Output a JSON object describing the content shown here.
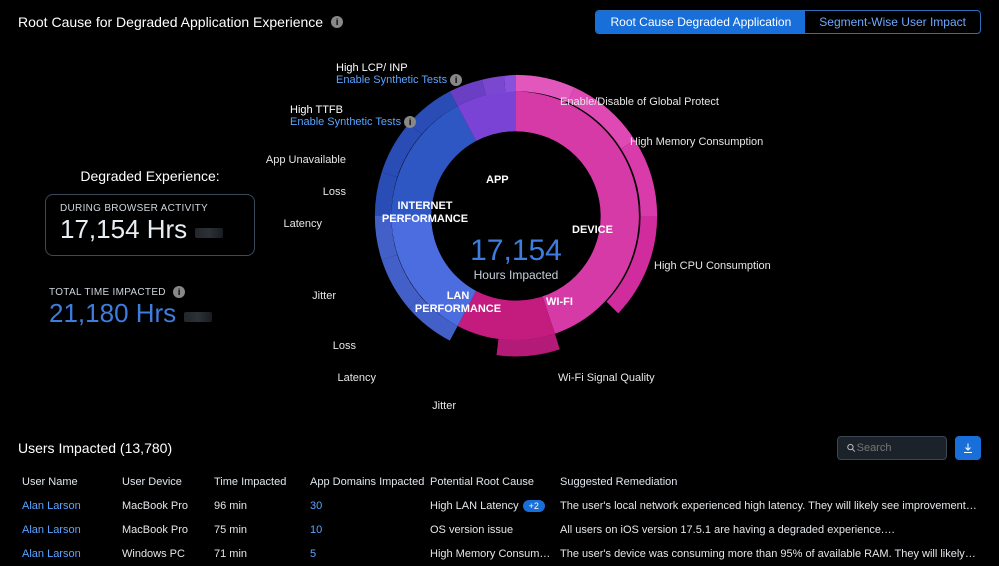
{
  "header": {
    "title": "Root Cause for Degraded Application Experience",
    "tabs": [
      "Root Cause Degraded Application",
      "Segment-Wise User Impact"
    ],
    "active_tab": 0
  },
  "stats": {
    "heading": "Degraded Experience:",
    "browser": {
      "label": "DURING BROWSER ACTIVITY",
      "value": "17,154 Hrs"
    },
    "total": {
      "label": "TOTAL TIME IMPACTED",
      "value": "21,180 Hrs"
    }
  },
  "chart_data": {
    "type": "sunburst",
    "center": {
      "value": "17,154",
      "label": "Hours Impacted"
    },
    "segments": [
      {
        "name": "APP",
        "color": "#6a3fc4",
        "share": 0.14,
        "children": [
          {
            "name": "High LCP/ INP",
            "link": "Enable Synthetic Tests"
          },
          {
            "name": "High TTFB",
            "link": "Enable Synthetic Tests"
          },
          {
            "name": "App Unavailable"
          }
        ]
      },
      {
        "name": "INTERNET PERFORMANCE",
        "color": "#2f57c4",
        "share": 0.14,
        "children": [
          {
            "name": "Loss"
          },
          {
            "name": "Latency"
          },
          {
            "name": "Jitter"
          }
        ]
      },
      {
        "name": "LAN PERFORMANCE",
        "color": "#4b6de0",
        "share": 0.14,
        "children": [
          {
            "name": "Loss"
          },
          {
            "name": "Latency"
          },
          {
            "name": "Jitter"
          }
        ]
      },
      {
        "name": "WI-FI",
        "color": "#c31b7e",
        "share": 0.14,
        "children": [
          {
            "name": "Wi-Fi Signal Quality"
          }
        ]
      },
      {
        "name": "DEVICE",
        "color": "#d63aa6",
        "share": 0.44,
        "children": [
          {
            "name": "Enable/Disable of Global Protect"
          },
          {
            "name": "High Memory Consumption"
          },
          {
            "name": "High CPU Consumption"
          }
        ]
      }
    ]
  },
  "table": {
    "title_prefix": "Users Impacted",
    "count": "13,780",
    "search_placeholder": "Search",
    "columns": [
      "User Name",
      "User Device",
      "Time Impacted",
      "App Domains Impacted",
      "Potential  Root Cause",
      "Suggested Remediation"
    ],
    "rows": [
      {
        "user": "Alan Larson",
        "device": "MacBook Pro",
        "time": "96 min",
        "domains": "30",
        "rc": "High LAN Latency",
        "rc_extra": "+2",
        "remediation": "The user's local network experienced high latency. They will likely see improvement if users on th…"
      },
      {
        "user": "Alan Larson",
        "device": "MacBook Pro",
        "time": "75 min",
        "domains": "10",
        "rc": "OS version issue",
        "rc_extra": null,
        "remediation": "All users on iOS version 17.5.1 are having a degraded experience.…"
      },
      {
        "user": "Alan Larson",
        "device": "Windows PC",
        "time": "71 min",
        "domains": "5",
        "rc": "High Memory Consumption",
        "rc_extra": null,
        "remediation": "The user's device was consuming more than 95% of available RAM. They will likely see improveme…"
      }
    ]
  }
}
